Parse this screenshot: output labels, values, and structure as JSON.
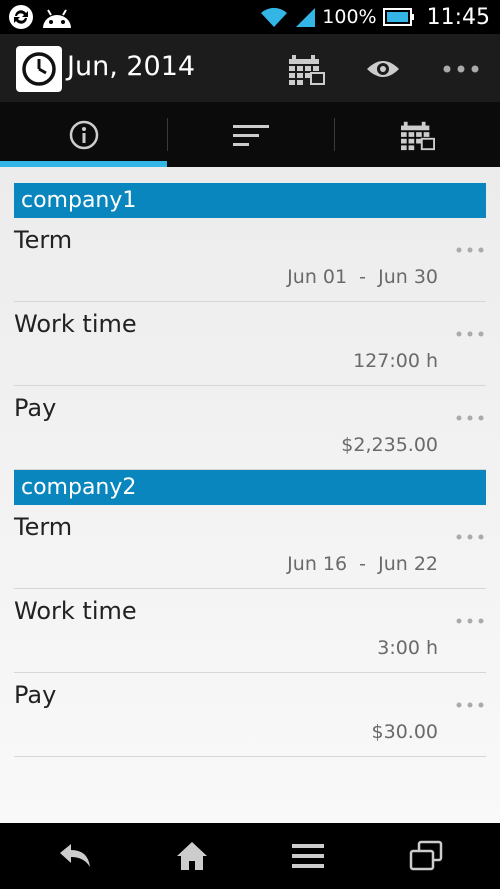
{
  "status_bar": {
    "battery_percent": "100%",
    "clock": "11:45",
    "icons": [
      "sync-icon",
      "android-icon",
      "wifi-icon",
      "signal-icon",
      "battery-icon"
    ]
  },
  "action_bar": {
    "title": "Jun, 2014",
    "icons": [
      "clock-logo-icon",
      "calendar-icon",
      "eye-icon",
      "overflow-menu-icon"
    ]
  },
  "tabs": [
    {
      "icon": "info-icon",
      "selected": true
    },
    {
      "icon": "sort-icon",
      "selected": false
    },
    {
      "icon": "calendar-icon",
      "selected": false
    }
  ],
  "sections": [
    {
      "header": "company1",
      "rows": [
        {
          "label": "Term",
          "value": "Jun 01  -  Jun 30"
        },
        {
          "label": "Work time",
          "value": "127:00 h"
        },
        {
          "label": "Pay",
          "value": "$2,235.00"
        }
      ]
    },
    {
      "header": "company2",
      "rows": [
        {
          "label": "Term",
          "value": "Jun 16  -  Jun 22"
        },
        {
          "label": "Work time",
          "value": "3:00 h"
        },
        {
          "label": "Pay",
          "value": "$30.00"
        }
      ]
    }
  ],
  "nav_bar": {
    "icons": [
      "back-icon",
      "home-icon",
      "menu-icon",
      "recent-apps-icon"
    ]
  },
  "colors": {
    "section_header": "#0a86bf",
    "tab_indicator": "#33b5e5",
    "action_bar": "#1c1c1c"
  }
}
